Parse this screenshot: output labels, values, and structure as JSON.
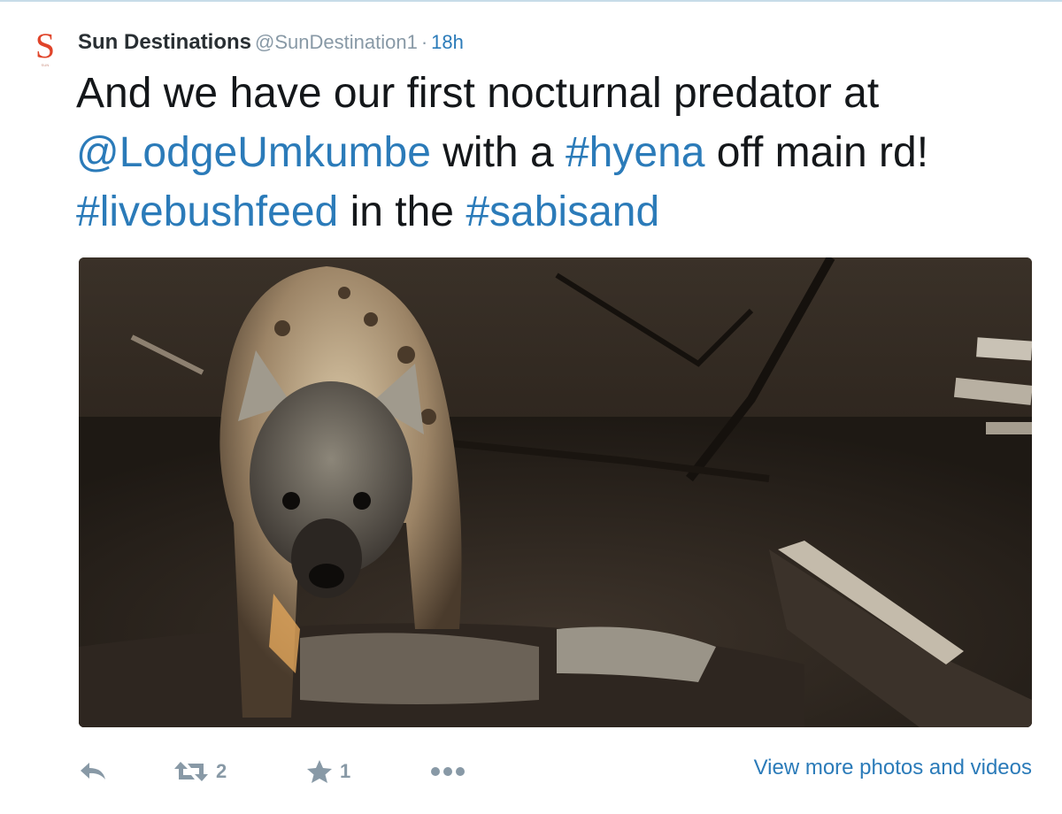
{
  "tweet": {
    "avatar": {
      "letter": "S",
      "subtext": "SUN DESTINATIONS"
    },
    "display_name": "Sun Destinations",
    "handle": "@SunDestination1",
    "separator": "·",
    "time": "18h",
    "text": {
      "line1": "And we have our first nocturnal predator at",
      "mention": "@LodgeUmkumbe",
      "part_with": " with a ",
      "hashtag_hyena": "#hyena",
      "part_off": " off main rd!",
      "hashtag_livebushfeed": "#livebushfeed",
      "part_in_the": " in the ",
      "hashtag_sabisand": "#sabisand"
    },
    "media_description_icon": "hyena-photo"
  },
  "actions": {
    "reply_icon": "reply-icon",
    "retweet_icon": "retweet-icon",
    "retweet_count": "2",
    "favorite_icon": "star-icon",
    "favorite_count": "1",
    "more_icon": "more-icon",
    "view_more_label": "View more photos and videos"
  },
  "colors": {
    "link": "#2b7bb9",
    "muted": "#8899a6",
    "text": "#14171a",
    "avatar_accent": "#e0442a"
  }
}
